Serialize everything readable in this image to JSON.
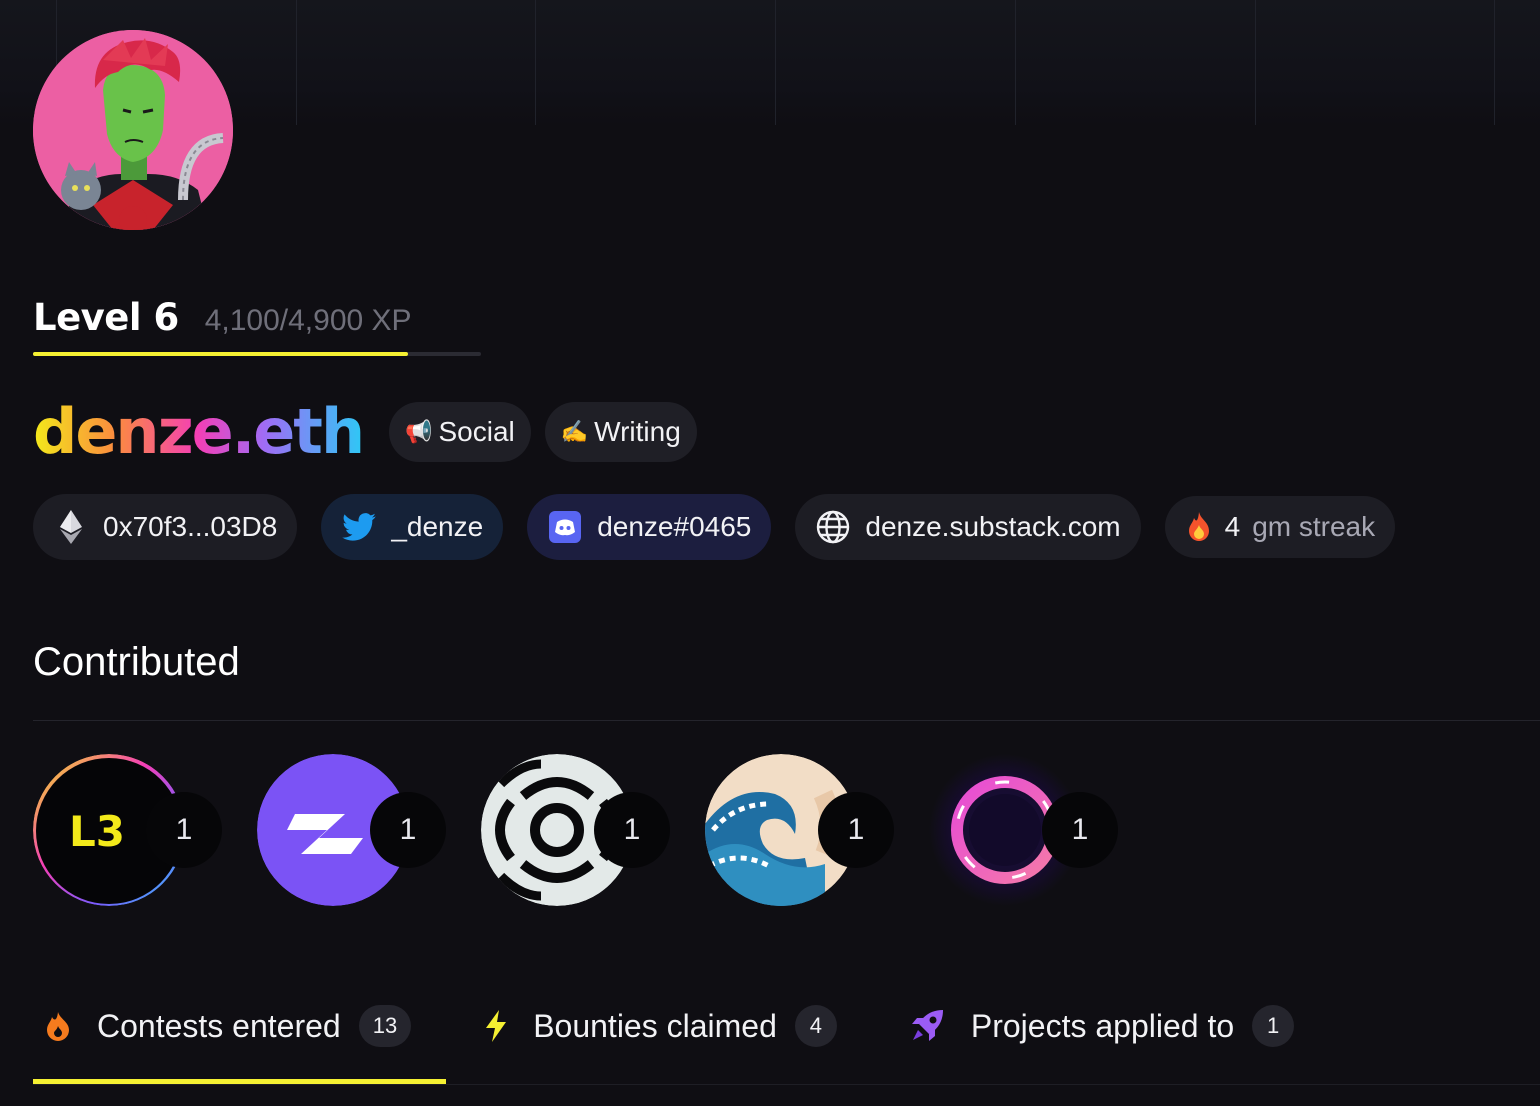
{
  "profile": {
    "level_label": "Level 6",
    "xp_current": "4,100",
    "xp_separator": "/",
    "xp_total": "4,900 XP",
    "xp_progress_fraction": 0.837,
    "ens_name": "denze.eth",
    "tags": [
      {
        "emoji": "📢",
        "label": "Social"
      },
      {
        "emoji": "✍️",
        "label": "Writing"
      }
    ]
  },
  "links": {
    "wallet": {
      "icon": "ethereum-icon",
      "label": "0x70f3...03D8"
    },
    "twitter": {
      "icon": "twitter-icon",
      "label": "_denze"
    },
    "discord": {
      "icon": "discord-icon",
      "label": "denze#0465"
    },
    "website": {
      "icon": "globe-icon",
      "label": "denze.substack.com"
    },
    "streak": {
      "icon": "fire-icon",
      "count": "4",
      "label": "gm streak"
    }
  },
  "contributed": {
    "title": "Contributed",
    "items": [
      {
        "name": "l3-logo",
        "logo_text": "L3",
        "count": "1"
      },
      {
        "name": "purple-z-logo",
        "count": "1"
      },
      {
        "name": "ring-segments-logo",
        "count": "1"
      },
      {
        "name": "wave-logo",
        "count": "1"
      },
      {
        "name": "glowing-ring-logo",
        "count": "1"
      }
    ]
  },
  "tabs": [
    {
      "icon": "fire-icon",
      "label": "Contests entered",
      "count": "13",
      "active": true
    },
    {
      "icon": "lightning-icon",
      "label": "Bounties claimed",
      "count": "4",
      "active": false
    },
    {
      "icon": "rocket-icon",
      "label": "Projects applied to",
      "count": "1",
      "active": false
    }
  ],
  "colors": {
    "background": "#0f0e13",
    "accent_yellow": "#f5f032",
    "chip_bg": "#1d1d24",
    "twitter_chip_bg": "#152238",
    "discord_chip_bg": "#1c1e3f"
  }
}
